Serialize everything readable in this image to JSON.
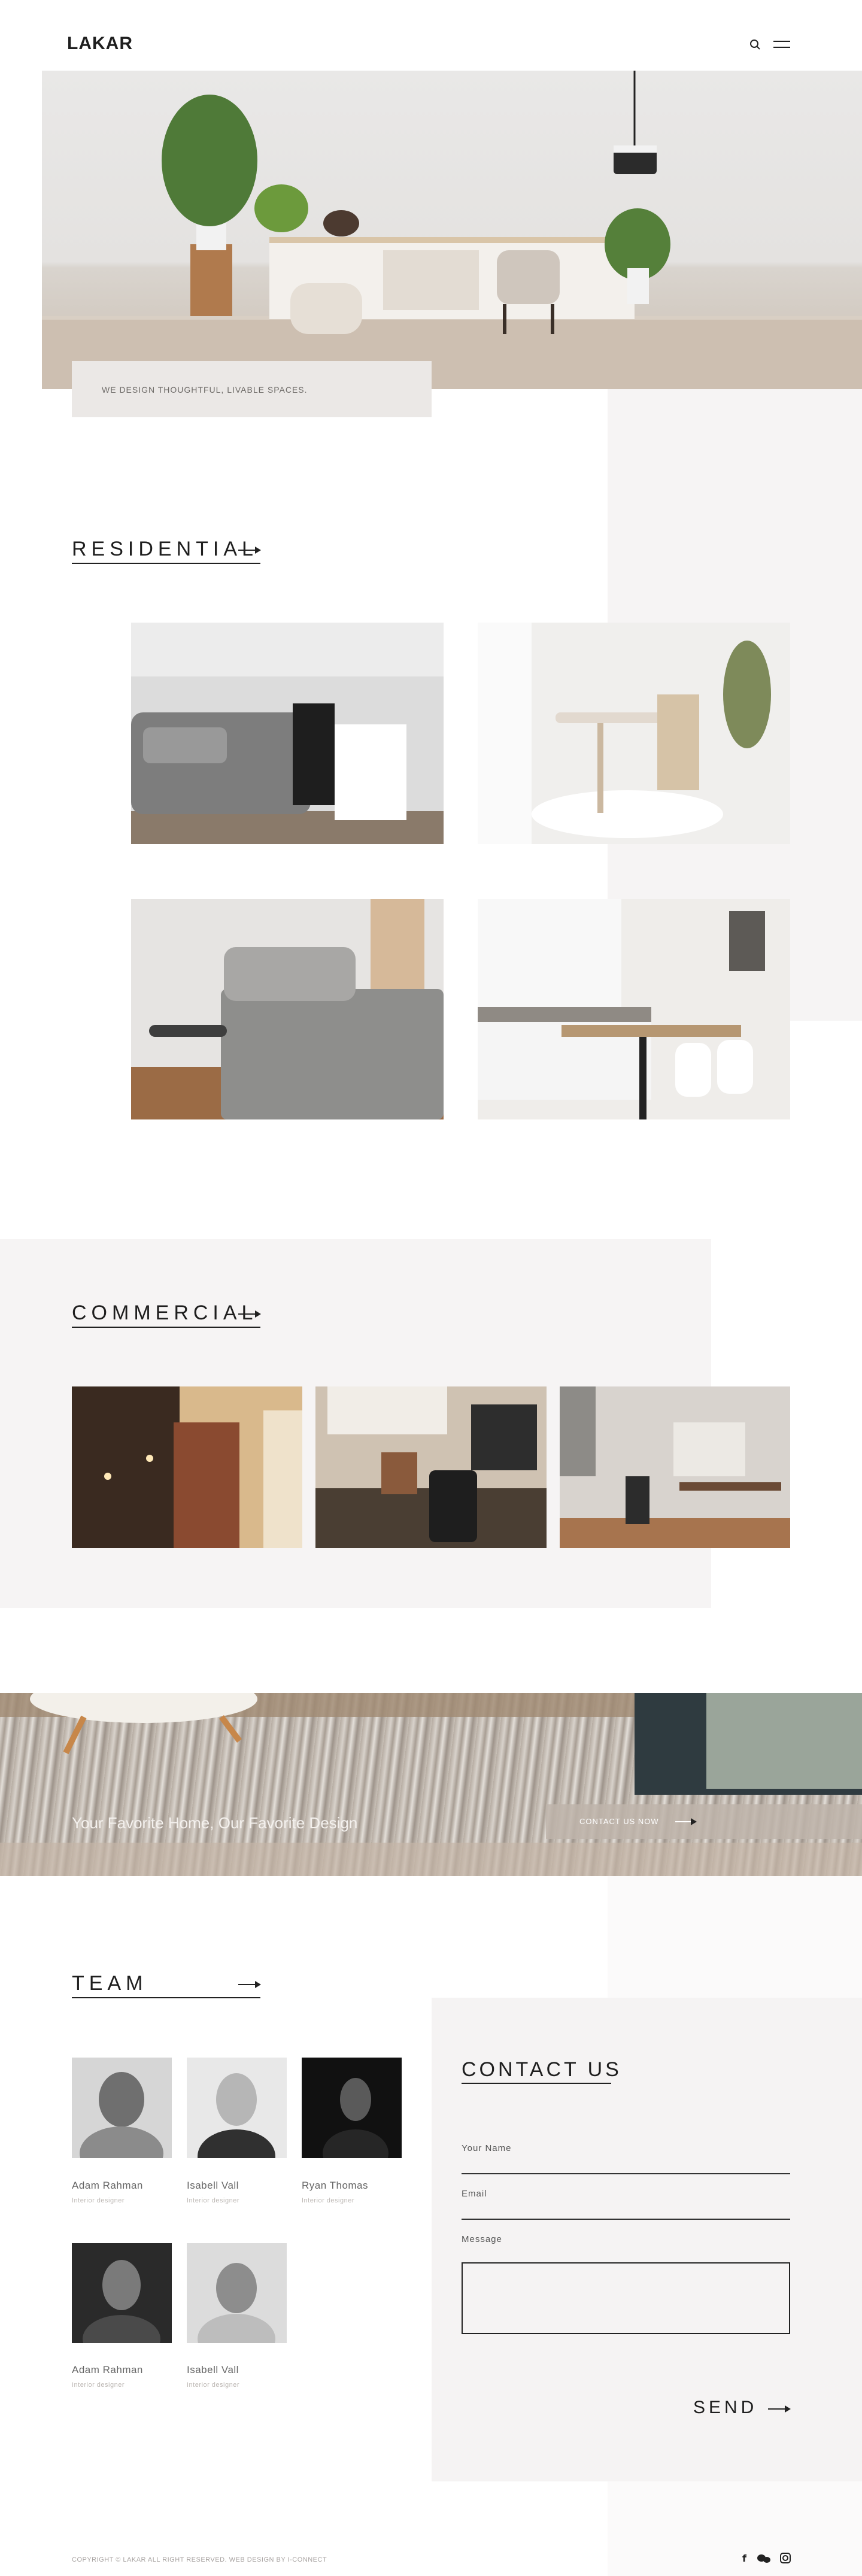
{
  "header": {
    "logo": "LAKAR",
    "icons": [
      "search-icon",
      "menu-icon"
    ]
  },
  "hero": {
    "caption": "WE DESIGN THOUGHTFUL, LIVABLE SPACES."
  },
  "residential": {
    "title": "RESIDENTIAL",
    "photos": [
      "living-room-photo",
      "dining-nook-photo",
      "bedroom-photo",
      "kitchen-dining-photo"
    ]
  },
  "commercial": {
    "title": "COMMERCIAL",
    "photos": [
      "brick-hallway-photo",
      "office-workspace-photo",
      "meeting-room-photo"
    ]
  },
  "banner": {
    "text": "Your Favorite Home, Our Favorite Design",
    "button": "CONTACT US NOW"
  },
  "team": {
    "title": "TEAM",
    "members": [
      {
        "name": "Adam Rahman",
        "role": "Interior designer"
      },
      {
        "name": "Isabell Vall",
        "role": "Interior designer"
      },
      {
        "name": "Ryan Thomas",
        "role": "Interior designer"
      },
      {
        "name": "Adam Rahman",
        "role": "Interior designer"
      },
      {
        "name": "Isabell Vall",
        "role": "Interior designer"
      }
    ]
  },
  "contact": {
    "title": "CONTACT US",
    "name_label": "Your Name",
    "email_label": "Email",
    "message_label": "Message",
    "send_label": "SEND"
  },
  "footer": {
    "copyright": "COPYRIGHT © LAKAR ALL RIGHT RESERVED. WEB DESIGN BY I-CONNECT",
    "social_icons": [
      "facebook-icon",
      "wechat-icon",
      "instagram-icon"
    ]
  },
  "colors": {
    "accent_dark": "#1e1e1e",
    "panel_tint": "#f6f4f4",
    "caption_bg": "#ebe8e6"
  }
}
